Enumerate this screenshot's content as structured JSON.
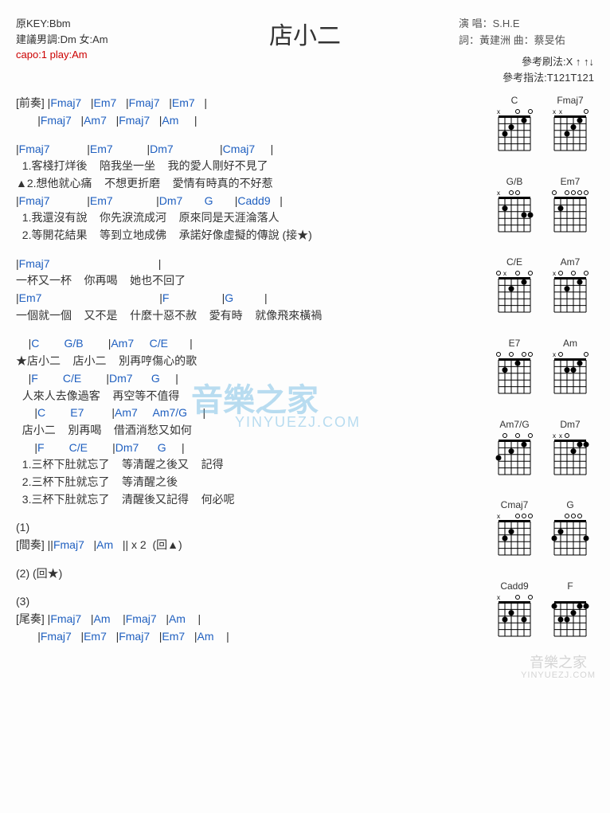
{
  "title": "店小二",
  "meta_left": {
    "key": "原KEY:Bbm",
    "suggest": "建議男調:Dm 女:Am",
    "capo": "capo:1 play:Am"
  },
  "meta_right": {
    "singer": "演 唱：S.H.E",
    "writer": "詞：黃建洲  曲：蔡旻佑"
  },
  "ref": {
    "strum": "參考刷法:X ↑ ↑↓",
    "pick": "參考指法:T121T121"
  },
  "intro": {
    "label": "[前奏]",
    "line1_chords": [
      "Fmaj7",
      "Em7",
      "Fmaj7",
      "Em7"
    ],
    "line2_chords": [
      "Fmaj7",
      "Am7",
      "Fmaj7",
      "Am"
    ]
  },
  "verse1": {
    "row1_chords": [
      "Fmaj7",
      "Em7",
      "Dm7",
      "Cmaj7"
    ],
    "row1_l1": "  1.客棧打烊後    陪我坐一坐    我的愛人剛好不見了",
    "row1_l2": "▲2.想他就心痛    不想更折磨    愛情有時真的不好惹",
    "row2_chords_a": [
      "Fmaj7",
      "Em7",
      "Dm7"
    ],
    "row2_chords_b": [
      "G",
      "Cadd9"
    ],
    "row2_l1": "  1.我還沒有說    你先淚流成河    原來同是天涯淪落人",
    "row2_l2": "  2.等開花結果    等到立地成佛    承諾好像虛擬的傳說 (接★)"
  },
  "bridge": {
    "row1_chord": "Fmaj7",
    "row1_lyr": "一杯又一杯    你再喝    她也不回了",
    "row2_chords": [
      "Em7",
      "F",
      "G"
    ],
    "row2_lyr": "一個就一個    又不是    什麼十惡不赦    愛有時    就像飛來橫禍"
  },
  "chorus": {
    "r1_ch": [
      "C",
      "G/B",
      "Am7",
      "C/E"
    ],
    "r1_ly": "★店小二    店小二    別再哼傷心的歌",
    "r2_ch": [
      "F",
      "C/E",
      "Dm7",
      "G"
    ],
    "r2_ly": "  人來人去像過客    再空等不值得",
    "r3_ch": [
      "C",
      "E7",
      "Am7",
      "Am7/G"
    ],
    "r3_ly": "  店小二    別再喝    借酒消愁又如何",
    "r4_ch": [
      "F",
      "C/E",
      "Dm7",
      "G"
    ],
    "r4_l1": "  1.三杯下肚就忘了    等清醒之後又    記得",
    "r4_l2": "  2.三杯下肚就忘了    等清醒之後",
    "r4_l3": "  3.三杯下肚就忘了    清醒後又記得    何必呢"
  },
  "tags": {
    "t1": "(1)",
    "interlude_label": "[間奏]",
    "interlude_chords": [
      "Fmaj7",
      "Am"
    ],
    "interlude_tail": "|| x 2  (回▲)",
    "t2": "(2) (回★)",
    "t3": "(3)",
    "outro_label": "[尾奏]",
    "outro_l1": [
      "Fmaj7",
      "Am",
      "Fmaj7",
      "Am"
    ],
    "outro_l2": [
      "Fmaj7",
      "Em7",
      "Fmaj7",
      "Em7",
      "Am"
    ]
  },
  "diagrams": [
    "C",
    "Fmaj7",
    "G/B",
    "Em7",
    "C/E",
    "Am7",
    "E7",
    "Am",
    "Am7/G",
    "Dm7",
    "Cmaj7",
    "G",
    "Cadd9",
    "F"
  ],
  "watermark": {
    "main": "音樂之家",
    "sub": "YINYUEZJ.COM"
  }
}
